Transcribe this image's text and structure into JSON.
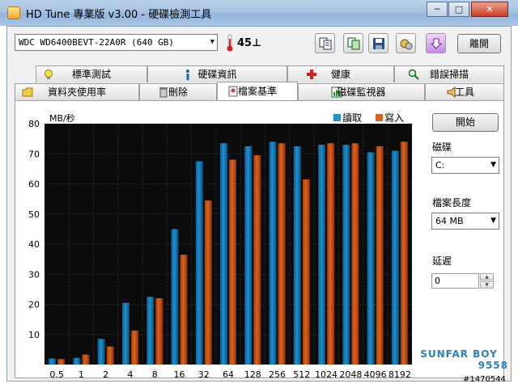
{
  "window": {
    "title": "HD Tune 專業版 v3.00 - 硬碟檢測工具",
    "buttons": {
      "minimize": "─",
      "maximize": "□",
      "close": "✕"
    }
  },
  "toolbar": {
    "drive": "WDC WD6400BEVT-22A0R (640 GB)",
    "temperature": "45⊥",
    "icons": [
      "copy-info-icon",
      "copy-screenshot-icon",
      "save-icon",
      "options-icon",
      "download-icon"
    ],
    "exit_label": "離開"
  },
  "tabs": {
    "row1": [
      {
        "label": "標準測試",
        "icon": "benchmark-icon"
      },
      {
        "label": "硬碟資訊",
        "icon": "info-icon"
      },
      {
        "label": "健康",
        "icon": "health-icon"
      },
      {
        "label": "錯誤掃描",
        "icon": "error-scan-icon"
      }
    ],
    "row2": [
      {
        "label": "資料夾使用率",
        "icon": "folder-icon"
      },
      {
        "label": "刪除",
        "icon": "erase-icon"
      },
      {
        "label": "檔案基準",
        "icon": "file-benchmark-icon"
      },
      {
        "label": "磁碟監視器",
        "icon": "disk-monitor-icon"
      },
      {
        "label": "工具",
        "icon": "tools-icon"
      }
    ],
    "active": "檔案基準"
  },
  "controls": {
    "start_label": "開始",
    "disk_label": "磁碟",
    "disk_value": "C:",
    "file_length_label": "檔案長度",
    "file_length_value": "64 MB",
    "delay_label": "延遲",
    "delay_value": "0"
  },
  "chart_data": {
    "type": "bar",
    "ylabel": "MB/秒",
    "ylim": [
      0,
      80
    ],
    "yticks": [
      10,
      20,
      30,
      40,
      50,
      60,
      70,
      80
    ],
    "categories": [
      "0.5",
      "1",
      "2",
      "4",
      "8",
      "16",
      "32",
      "64",
      "128",
      "256",
      "512",
      "1024",
      "2048",
      "4096",
      "8192"
    ],
    "series": [
      {
        "name": "讀取",
        "color": "#1e8fcf",
        "values": [
          2,
          2.2,
          8.5,
          20.5,
          22.5,
          45,
          67.5,
          73.5,
          72.5,
          74,
          72.5,
          73,
          73,
          70.5,
          71
        ]
      },
      {
        "name": "寫入",
        "color": "#e0621e",
        "values": [
          1.8,
          3.3,
          6,
          11.3,
          22,
          36.5,
          54.5,
          68,
          69.5,
          73.5,
          61.5,
          73.5,
          73.5,
          72.5,
          74
        ]
      }
    ],
    "grid": true,
    "legend": "top-right"
  },
  "watermark": {
    "line1": "SUNFAR BOY",
    "line2": "9558"
  },
  "post_id": "#1470544"
}
